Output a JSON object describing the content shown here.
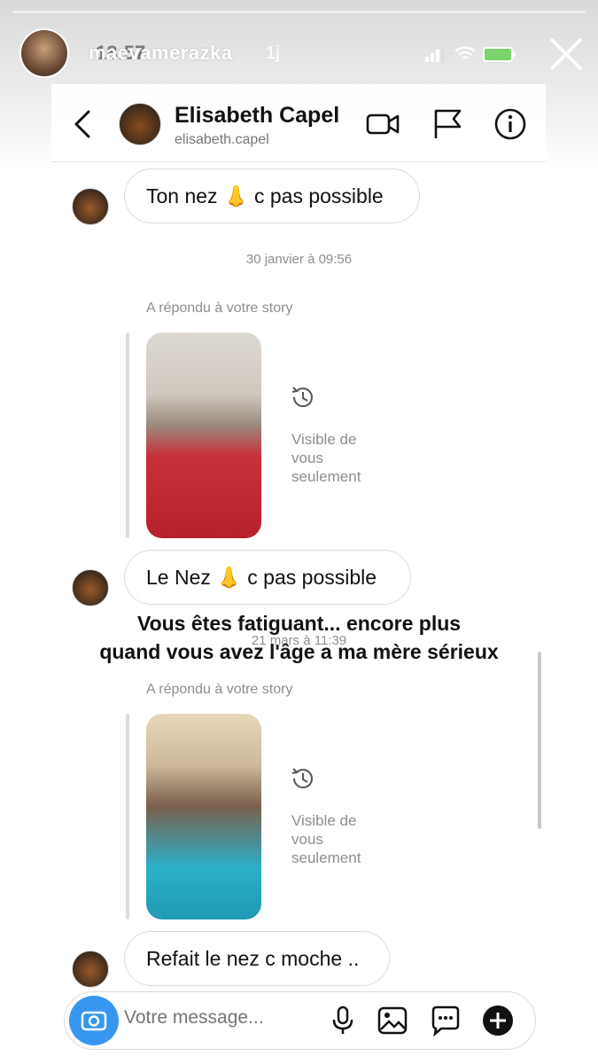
{
  "story": {
    "username": "maevamerazka",
    "time_ago": "1j",
    "clock": "18:57"
  },
  "chat": {
    "contact_name": "Elisabeth Capel",
    "contact_handle": "elisabeth.capel"
  },
  "messages": {
    "m1": "Ton nez 👃 c pas possible",
    "ts1": "30 janvier à 09:56",
    "reply1_label": "A répondu à votre story",
    "reply1_visible": "Visible de vous seulement",
    "m2": "Le Nez 👃 c pas possible",
    "ts2": "21 mars à 11:39",
    "reply2_label": "A répondu à votre story",
    "reply2_visible": "Visible de vous seulement",
    "m3": "Refait le nez c moche .."
  },
  "overlay": {
    "line1": "Vous êtes fatiguant... encore plus",
    "line2": "quand vous avez l'âge a ma mère sérieux"
  },
  "composer": {
    "placeholder": "Votre message..."
  },
  "icons": {
    "back": "chevron-left-icon",
    "video": "video-camera-icon",
    "report": "flag-icon",
    "info": "info-icon",
    "history": "history-icon",
    "mic": "microphone-icon",
    "gallery": "image-icon",
    "sticker": "sticker-icon",
    "add": "plus-icon"
  },
  "colors": {
    "accent": "#3797f0",
    "bubble_border": "#dbdbdb",
    "meta_text": "#8e8e8e"
  }
}
